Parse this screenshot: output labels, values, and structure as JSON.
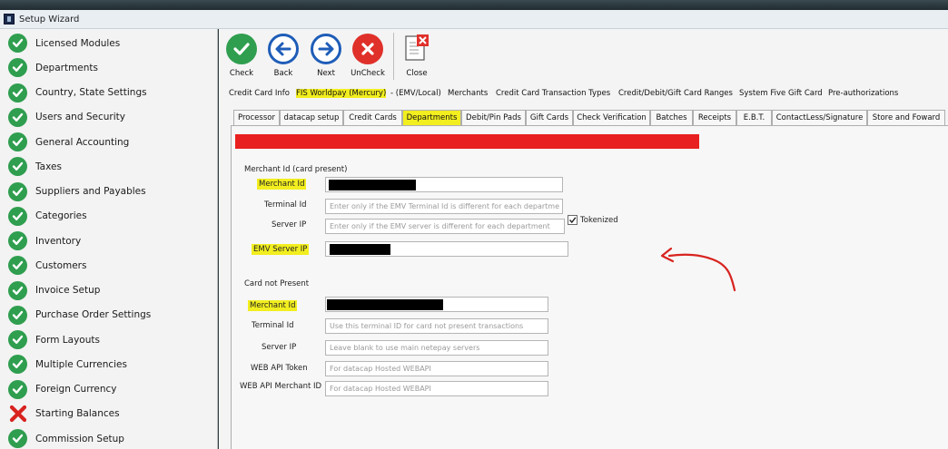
{
  "window": {
    "title": "Setup Wizard"
  },
  "sidebar": {
    "items": [
      {
        "label": "Licensed Modules",
        "status": "done"
      },
      {
        "label": "Departments",
        "status": "done"
      },
      {
        "label": "Country, State Settings",
        "status": "done"
      },
      {
        "label": "Users and Security",
        "status": "done"
      },
      {
        "label": "General Accounting",
        "status": "done"
      },
      {
        "label": "Taxes",
        "status": "done"
      },
      {
        "label": "Suppliers and Payables",
        "status": "done"
      },
      {
        "label": "Categories",
        "status": "done"
      },
      {
        "label": "Inventory",
        "status": "done"
      },
      {
        "label": "Customers",
        "status": "done"
      },
      {
        "label": "Invoice Setup",
        "status": "done"
      },
      {
        "label": "Purchase Order Settings",
        "status": "done"
      },
      {
        "label": "Form Layouts",
        "status": "done"
      },
      {
        "label": "Multiple Currencies",
        "status": "done"
      },
      {
        "label": "Foreign Currency",
        "status": "done"
      },
      {
        "label": "Starting Balances",
        "status": "error"
      },
      {
        "label": "Commission Setup",
        "status": "done"
      }
    ]
  },
  "toolbar": {
    "check": "Check",
    "back": "Back",
    "next": "Next",
    "uncheck": "UnCheck",
    "close": "Close"
  },
  "main_tabs": [
    "Credit Card Info",
    "FIS Worldpay (Mercury)",
    "- (EMV/Local)",
    "Merchants",
    "Credit Card Transaction Types",
    "Credit/Debit/Gift Card Ranges",
    "System Five Gift Card",
    "Pre-authorizations"
  ],
  "sub_tabs": [
    "Processor",
    "datacap setup",
    "Credit Cards",
    "Departments",
    "Debit/Pin Pads",
    "Gift Cards",
    "Check Verification",
    "Batches",
    "Receipts",
    "E.B.T.",
    "ContactLess/Signature",
    "Store and Foward"
  ],
  "card_present": {
    "section": "Merchant Id (card present)",
    "merchant_id_label": "Merchant Id",
    "terminal_id_label": "Terminal Id",
    "terminal_id_placeholder": "Enter only if the EMV Terminal Id is different for each departme",
    "server_ip_label": "Server IP",
    "server_ip_placeholder": "Enter only if the EMV server is different for each department",
    "emv_server_ip_label": "EMV Server IP",
    "tokenized_label": "Tokenized",
    "tokenized_checked": true
  },
  "card_not_present": {
    "section": "Card not Present",
    "merchant_id_label": "Merchant Id",
    "terminal_id_label": "Terminal Id",
    "terminal_id_placeholder": "Use this terminal ID for card not present transactions",
    "server_ip_label": "Server IP",
    "server_ip_placeholder": "Leave blank to use main netepay servers",
    "web_api_token_label": "WEB API Token",
    "web_api_token_placeholder": "For datacap Hosted WEBAPI",
    "web_api_merchant_label": "WEB API Merchant ID",
    "web_api_merchant_placeholder": "For datacap Hosted WEBAPI"
  },
  "colors": {
    "highlight": "#f2ee1f",
    "done": "#2f9e4f",
    "error": "#d8231f",
    "redbar": "#e8201f"
  }
}
